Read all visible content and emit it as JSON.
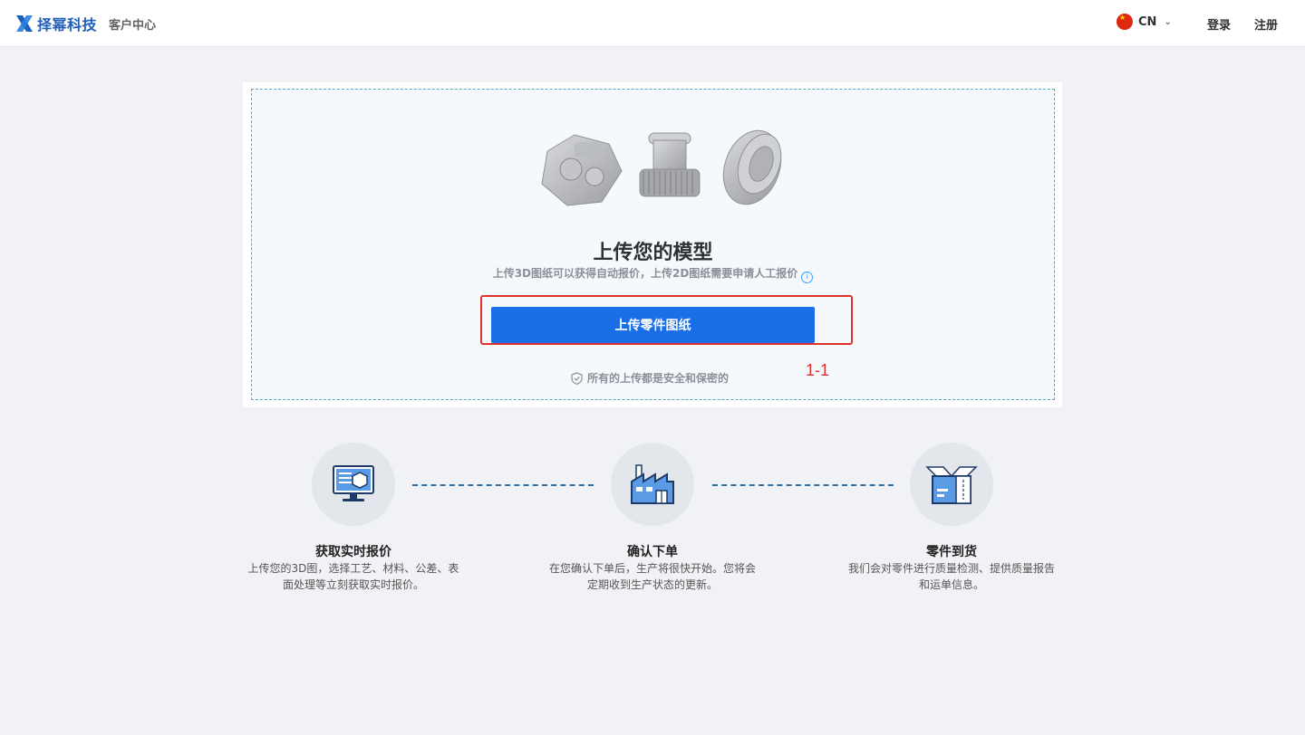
{
  "header": {
    "brand": "择幂科技",
    "portal": "客户中心",
    "language": "CN",
    "login": "登录",
    "register": "注册"
  },
  "upload": {
    "title": "上传您的模型",
    "subtitle": "上传3D图纸可以获得自动报价，上传2D图纸需要申请人工报价",
    "button": "上传零件图纸",
    "security_note": "所有的上传都是安全和保密的",
    "annotation": "1-1"
  },
  "steps": [
    {
      "icon": "monitor-quote-icon",
      "title": "获取实时报价",
      "desc": [
        "上传您的3D图，选择工艺、材料、公差、表",
        "面处理等立刻获取实时报价。"
      ]
    },
    {
      "icon": "factory-icon",
      "title": "确认下单",
      "desc": [
        "在您确认下单后，生产将很快开始。您将会",
        "定期收到生产状态的更新。"
      ]
    },
    {
      "icon": "package-icon",
      "title": "零件到货",
      "desc": [
        "我们会对零件进行质量检测、提供质量报告",
        "和运单信息。"
      ]
    }
  ],
  "colors": {
    "primary": "#1a6ee6",
    "brand": "#1f5fb8",
    "highlight": "#e0312d",
    "background": "#f0f2f5"
  }
}
